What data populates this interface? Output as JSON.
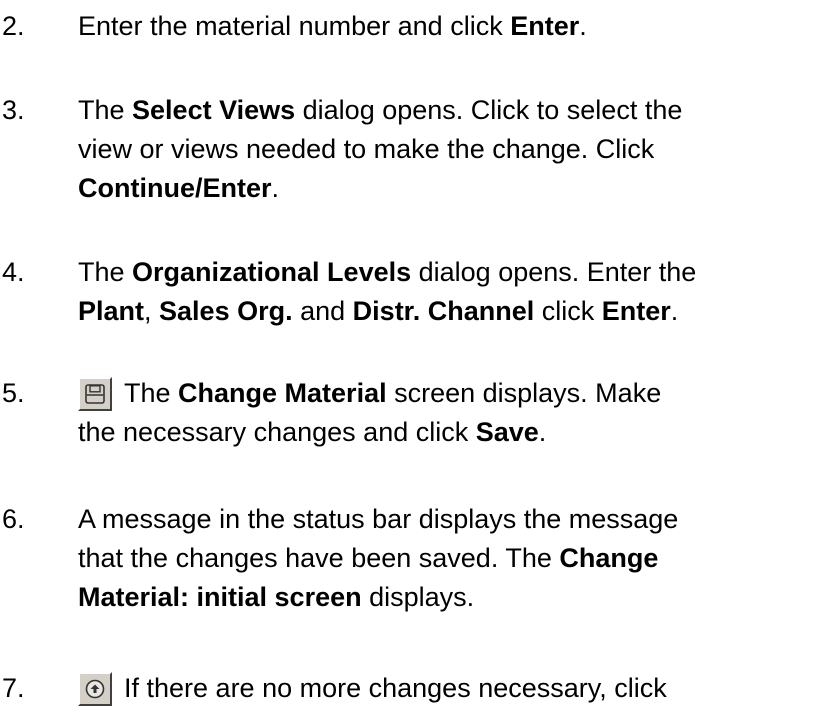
{
  "steps": [
    {
      "number": "2.",
      "lines": [
        [
          {
            "text": "Enter the material number and click ",
            "bold": false
          },
          {
            "text": "Enter",
            "bold": true
          },
          {
            "text": ".",
            "bold": false
          }
        ]
      ]
    },
    {
      "number": "3.",
      "lines": [
        [
          {
            "text": "The ",
            "bold": false
          },
          {
            "text": "Select Views",
            "bold": true
          },
          {
            "text": " dialog opens.  Click to select the",
            "bold": false
          }
        ],
        [
          {
            "text": "view or views needed to make the change.  Click",
            "bold": false
          }
        ],
        [
          {
            "text": "Continue/Enter",
            "bold": true
          },
          {
            "text": ".",
            "bold": false
          }
        ]
      ]
    },
    {
      "number": "4.",
      "lines": [
        [
          {
            "text": "The ",
            "bold": false
          },
          {
            "text": "Organizational Levels",
            "bold": true
          },
          {
            "text": " dialog opens.  Enter the",
            "bold": false
          }
        ],
        [
          {
            "text": "Plant",
            "bold": true
          },
          {
            "text": ", ",
            "bold": false
          },
          {
            "text": "Sales Org.",
            "bold": true
          },
          {
            "text": " and ",
            "bold": false
          },
          {
            "text": "Distr. Channel",
            "bold": true
          },
          {
            "text": " click ",
            "bold": false
          },
          {
            "text": "Enter",
            "bold": true
          },
          {
            "text": ".",
            "bold": false
          }
        ]
      ]
    },
    {
      "number": "5.",
      "icon": "save-icon",
      "lines": [
        [
          {
            "text": "The ",
            "bold": false
          },
          {
            "text": "Change Material",
            "bold": true
          },
          {
            "text": " screen displays.  Make",
            "bold": false
          }
        ],
        [
          {
            "text": "the necessary changes and click ",
            "bold": false
          },
          {
            "text": "Save",
            "bold": true
          },
          {
            "text": ".",
            "bold": false
          }
        ]
      ]
    },
    {
      "number": "6.",
      "lines": [
        [
          {
            "text": "A message in the status bar displays the message",
            "bold": false
          }
        ],
        [
          {
            "text": "that the changes have been saved.  The ",
            "bold": false
          },
          {
            "text": "Change",
            "bold": true
          }
        ],
        [
          {
            "text": "Material: initial screen",
            "bold": true
          },
          {
            "text": " displays.",
            "bold": false
          }
        ]
      ]
    },
    {
      "number": "7.",
      "icon": "back-icon",
      "lines": [
        [
          {
            "text": "If there are no more changes necessary, click",
            "bold": false
          }
        ]
      ]
    }
  ]
}
